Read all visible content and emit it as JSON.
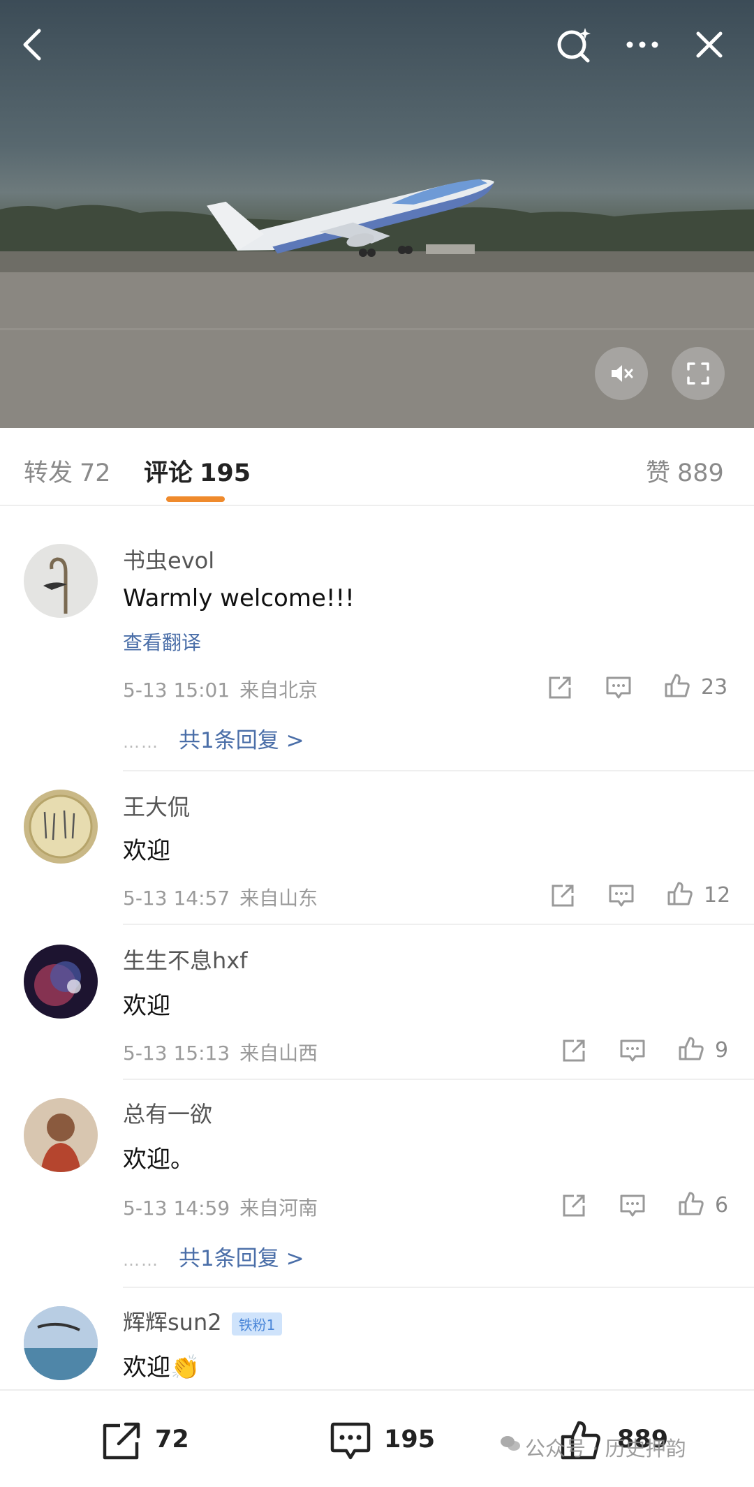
{
  "tabs": {
    "repost_label": "转发",
    "repost_count": "72",
    "comment_label": "评论",
    "comment_count": "195",
    "like_label": "赞",
    "like_count": "889"
  },
  "comments": [
    {
      "username": "书虫evol",
      "text": "Warmly welcome!!!",
      "translate": "查看翻译",
      "time": "5-13 15:01",
      "location": "来自北京",
      "likes": "23",
      "replies": "共1条回复 >",
      "dots": "……"
    },
    {
      "username": "王大侃",
      "text": "欢迎",
      "time": "5-13 14:57",
      "location": "来自山东",
      "likes": "12"
    },
    {
      "username": "生生不息hxf",
      "text": "欢迎",
      "time": "5-13 15:13",
      "location": "来自山西",
      "likes": "9"
    },
    {
      "username": "总有一欲",
      "text": "欢迎。",
      "time": "5-13 14:59",
      "location": "来自河南",
      "likes": "6",
      "replies": "共1条回复 >",
      "dots": "……"
    },
    {
      "username": "辉辉sun2",
      "badge": "铁粉1",
      "text": "欢迎👏"
    }
  ],
  "bottom_bar": {
    "repost_count": "72",
    "comment_count": "195",
    "like_count": "889"
  },
  "watermark": "公众号 · 历史押韵",
  "colors": {
    "accent_underline": "#ef8a2c",
    "link_blue": "#4a6ea8"
  },
  "icons": [
    "back-icon",
    "search-icon",
    "more-icon",
    "close-icon",
    "mute-icon",
    "fullscreen-icon",
    "share-icon",
    "comment-icon",
    "like-icon",
    "wechat-icon"
  ]
}
